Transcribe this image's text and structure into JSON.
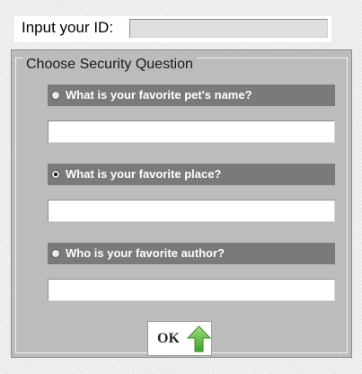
{
  "id_prompt": {
    "label": "Input your ID:",
    "value": "",
    "placeholder": ""
  },
  "security": {
    "legend": "Choose Security Question",
    "questions": [
      {
        "label": "What is your favorite pet's name?",
        "checked": false,
        "answer": ""
      },
      {
        "label": "What is your favorite place?",
        "checked": true,
        "answer": ""
      },
      {
        "label": "Who is your favorite author?",
        "checked": false,
        "answer": ""
      }
    ]
  },
  "ok_button": {
    "label": "OK",
    "icon": "up-arrow-icon",
    "icon_color": "#6cc24a"
  },
  "colors": {
    "panel": "#bcbcbc",
    "question_bar": "#7a7a7a",
    "question_text": "#ffffff"
  }
}
